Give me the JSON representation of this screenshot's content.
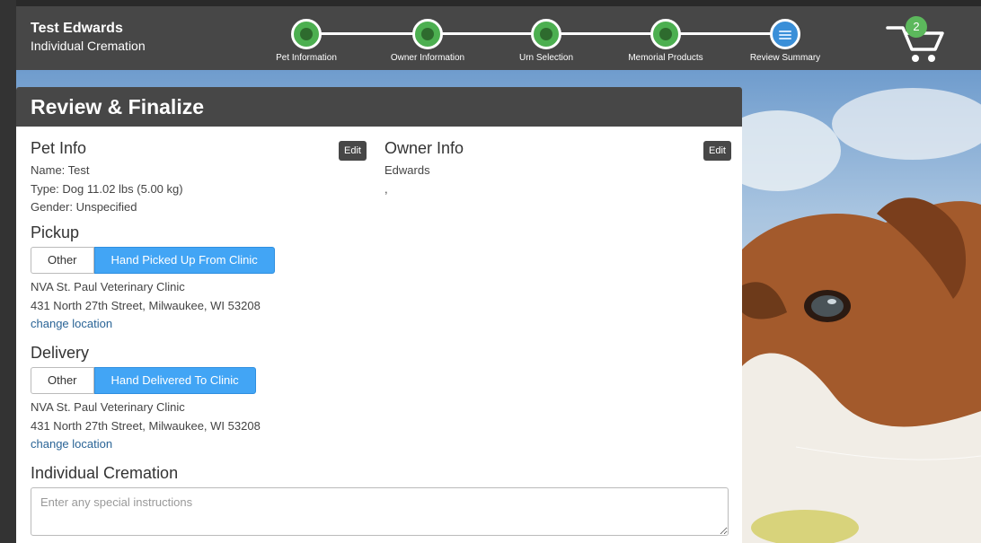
{
  "header": {
    "pet_name": "Test Edwards",
    "service": "Individual Cremation",
    "steps": [
      {
        "label": "Pet Information",
        "status": "complete"
      },
      {
        "label": "Owner Information",
        "status": "complete"
      },
      {
        "label": "Urn Selection",
        "status": "complete"
      },
      {
        "label": "Memorial Products",
        "status": "complete"
      },
      {
        "label": "Review Summary",
        "status": "active"
      }
    ],
    "cart_count": "2"
  },
  "panel": {
    "title": "Review & Finalize",
    "pet_info": {
      "heading": "Pet Info",
      "edit_label": "Edit",
      "name": "Name: Test",
      "type": "Type: Dog 11.02 lbs (5.00 kg)",
      "gender": "Gender: Unspecified"
    },
    "owner_info": {
      "heading": "Owner Info",
      "edit_label": "Edit",
      "name": "Edwards",
      "address": ","
    },
    "pickup": {
      "heading": "Pickup",
      "options": [
        "Other",
        "Hand Picked Up From Clinic"
      ],
      "selected": "Hand Picked Up From Clinic",
      "clinic": "NVA St. Paul Veterinary Clinic",
      "address": "431 North 27th Street, Milwaukee, WI 53208",
      "change_link": "change location"
    },
    "delivery": {
      "heading": "Delivery",
      "options": [
        "Other",
        "Hand Delivered To Clinic"
      ],
      "selected": "Hand Delivered To Clinic",
      "clinic": "NVA St. Paul Veterinary Clinic",
      "address": "431 North 27th Street, Milwaukee, WI 53208",
      "change_link": "change location"
    },
    "cremation": {
      "heading": "Individual Cremation",
      "instructions_placeholder": "Enter any special instructions"
    }
  },
  "colors": {
    "header_bg": "#474747",
    "step_complete": "#4caf50",
    "step_active": "#3a8fd8",
    "selected_button": "#42a5f5",
    "link": "#2a6496"
  }
}
